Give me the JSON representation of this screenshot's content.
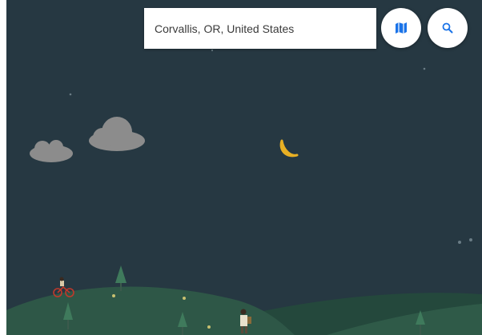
{
  "search": {
    "value": "Corvallis, OR, United States",
    "icon": "search-icon"
  },
  "buttons": {
    "map_icon": "map-icon",
    "zoom_icon": "zoom-icon"
  },
  "colors": {
    "sky": "#263842",
    "hill_front": "#2e5747",
    "hill_back": "#24483c",
    "moon": "#e8b024",
    "cloud": "#8c8c8c",
    "accent": "#1a73e8"
  }
}
